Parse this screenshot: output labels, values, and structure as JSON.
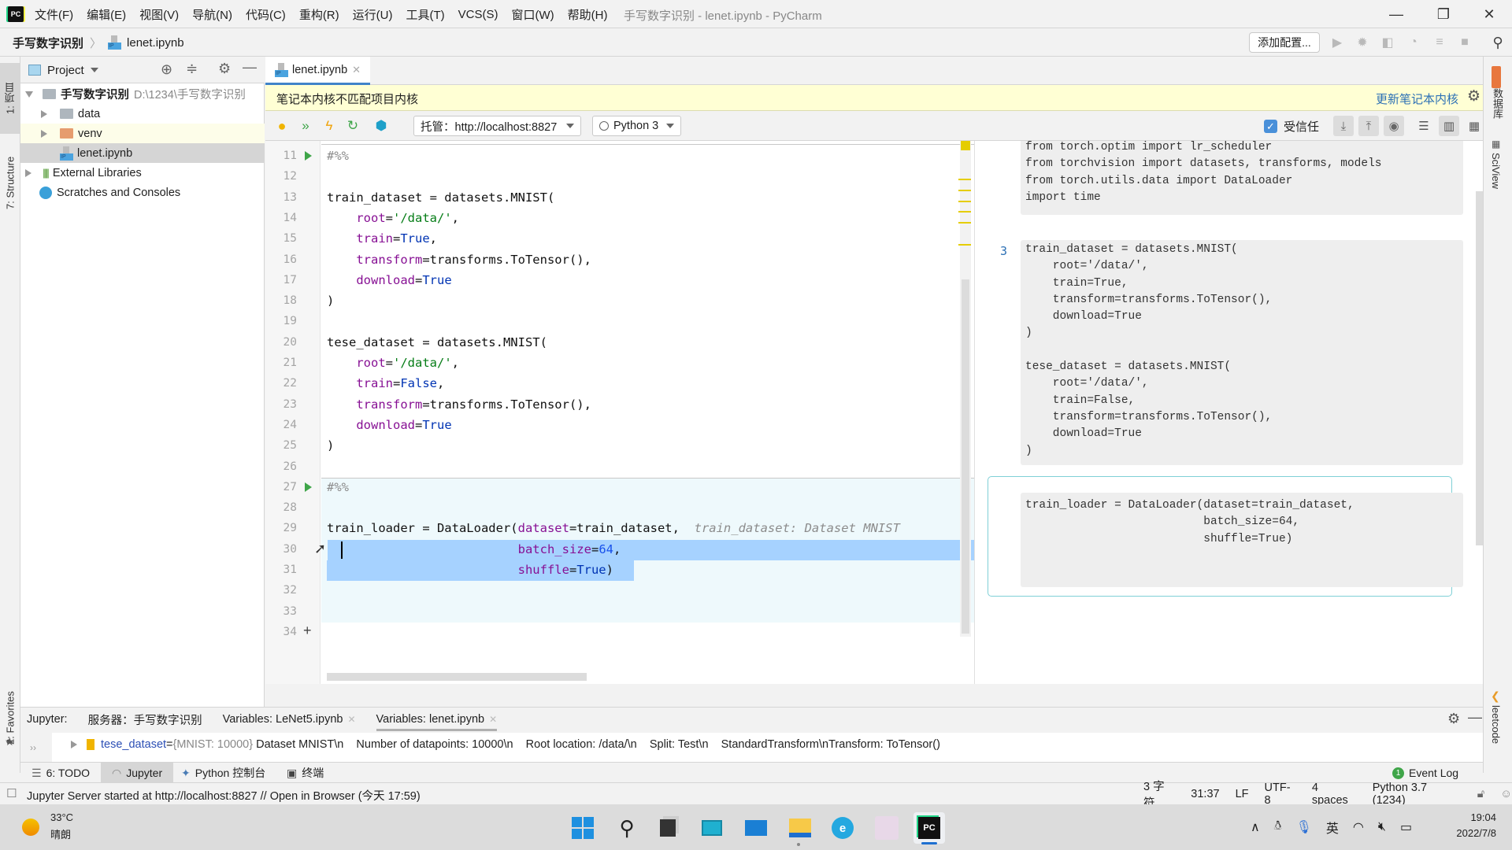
{
  "titlebar": {
    "app_logo": "PC",
    "menu": [
      "文件(F)",
      "编辑(E)",
      "视图(V)",
      "导航(N)",
      "代码(C)",
      "重构(R)",
      "运行(U)",
      "工具(T)",
      "VCS(S)",
      "窗口(W)",
      "帮助(H)"
    ],
    "window_title": "手写数字识别 - lenet.ipynb - PyCharm",
    "minimize": "—",
    "restore": "❐",
    "close": "✕"
  },
  "navbar": {
    "breadcrumb": [
      "手写数字识别",
      "lenet.ipynb"
    ],
    "add_config": "添加配置...",
    "run_icons": [
      "run-icon",
      "debug-icon",
      "coverage-icon",
      "profile-icon",
      "concurrency-icon",
      "stop-icon",
      "search-icon"
    ]
  },
  "left_stripe": {
    "tabs": [
      "1: 项目",
      "7: Structure",
      "2: Favorites"
    ]
  },
  "project": {
    "title": "Project",
    "tree": [
      {
        "label": "手写数字识别",
        "path": "D:\\1234\\手写数字识别",
        "type": "root"
      },
      {
        "label": "data",
        "type": "folder"
      },
      {
        "label": "venv",
        "type": "folder-venv"
      },
      {
        "label": "lenet.ipynb",
        "type": "notebook"
      },
      {
        "label": "External Libraries",
        "type": "lib"
      },
      {
        "label": "Scratches and Consoles",
        "type": "scratch"
      }
    ]
  },
  "editor": {
    "tab": "lenet.ipynb",
    "banner_text": "笔记本内核不匹配项目内核",
    "banner_action": "更新笔记本内核",
    "server": "托管：http://localhost:8827",
    "kernel": "Python 3",
    "trusted_label": "受信任",
    "trusted": true,
    "lines": [
      {
        "n": "11",
        "html": "<span class=\"cm\">#%%</span>",
        "run": true
      },
      {
        "n": "12",
        "html": ""
      },
      {
        "n": "13",
        "html": "train_dataset = datasets.MNIST("
      },
      {
        "n": "14",
        "html": "    <span class=\"prm\">root</span>=<span class=\"str\">'/data/'</span>,"
      },
      {
        "n": "15",
        "html": "    <span class=\"prm\">train</span>=<span class=\"kw\">True</span>,"
      },
      {
        "n": "16",
        "html": "    <span class=\"prm\">transform</span>=transforms.ToTensor(),"
      },
      {
        "n": "17",
        "html": "    <span class=\"prm\">download</span>=<span class=\"kw\">True</span>"
      },
      {
        "n": "18",
        "html": ")"
      },
      {
        "n": "19",
        "html": ""
      },
      {
        "n": "20",
        "html": "tese_dataset = datasets.MNIST("
      },
      {
        "n": "21",
        "html": "    <span class=\"prm\">root</span>=<span class=\"str\">'/data/'</span>,"
      },
      {
        "n": "22",
        "html": "    <span class=\"prm\">train</span>=<span class=\"kw\">False</span>,"
      },
      {
        "n": "23",
        "html": "    <span class=\"prm\">transform</span>=transforms.ToTensor(),"
      },
      {
        "n": "24",
        "html": "    <span class=\"prm\">download</span>=<span class=\"kw\">True</span>"
      },
      {
        "n": "25",
        "html": ")"
      },
      {
        "n": "26",
        "html": ""
      },
      {
        "n": "27",
        "html": "<span class=\"cm\">#%%</span>",
        "run": true
      },
      {
        "n": "28",
        "html": ""
      },
      {
        "n": "29",
        "html": "train_loader = DataLoader(<span class=\"prm\">dataset</span>=train_dataset,  <span class=\"hint\">train_dataset: Dataset MNIST</span>"
      },
      {
        "n": "30",
        "html": "                          <span class=\"prm\">batch_size</span>=<span class=\"num\">64</span>,"
      },
      {
        "n": "31",
        "html": "                          <span class=\"prm\">shuffle</span>=<span class=\"kw\">True</span>)"
      },
      {
        "n": "32",
        "html": ""
      },
      {
        "n": "33",
        "html": ""
      },
      {
        "n": "34",
        "html": "",
        "add": true
      }
    ]
  },
  "preview": {
    "cell1": [
      "from torch.optim import lr_scheduler",
      "from torchvision import datasets, transforms, models",
      "from torch.utils.data import DataLoader",
      "import time"
    ],
    "cell2_number": "3",
    "cell2": [
      "train_dataset = datasets.MNIST(",
      "    root='/data/',",
      "    train=True,",
      "    transform=transforms.ToTensor(),",
      "    download=True",
      ")",
      "",
      "tese_dataset = datasets.MNIST(",
      "    root='/data/',",
      "    train=False,",
      "    transform=transforms.ToTensor(),",
      "    download=True",
      ")"
    ],
    "cell3": [
      "train_loader = DataLoader(dataset=train_dataset,",
      "                          batch_size=64,",
      "                          shuffle=True)"
    ]
  },
  "right_stripe": {
    "tabs": [
      "数据库",
      "SciView",
      "leetcode"
    ]
  },
  "bottom": {
    "label": "Jupyter:",
    "tabs": [
      "服务器：手写数字识别",
      "Variables: LeNet5.ipynb",
      "Variables: lenet.ipynb"
    ],
    "variable": {
      "name": "tese_dataset",
      "eq": " = ",
      "type": "{MNIST: 10000}",
      "value": " Dataset MNIST\\n    Number of datapoints: 10000\\n    Root location: /data/\\n    Split: Test\\n    StandardTransform\\nTransform: ToTensor()"
    },
    "tool_tabs": [
      "6: TODO",
      "Jupyter",
      "Python 控制台",
      "终端"
    ],
    "event_log": "Event Log",
    "event_count": "1"
  },
  "status": {
    "message": "Jupyter Server started at http://localhost:8827 // Open in Browser (今天 17:59)",
    "chars": "3 字符",
    "position": "31:37",
    "line_sep": "LF",
    "encoding": "UTF-8",
    "indent": "4 spaces",
    "interpreter": "Python 3.7 (1234)"
  },
  "taskbar": {
    "weather_temp": "33°C",
    "weather_desc": "晴朗",
    "ime": "英",
    "time": "19:04",
    "date": "2022/7/8"
  }
}
